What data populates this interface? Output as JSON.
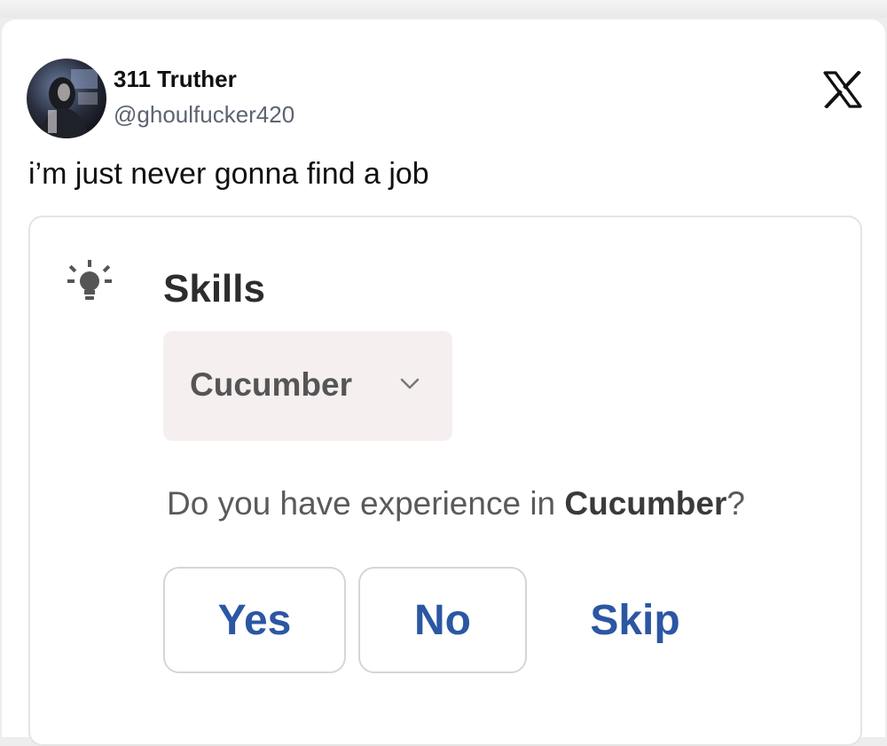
{
  "tweet": {
    "display_name": "311 Truther",
    "handle": "@ghoulfucker420",
    "text": "i’m just never gonna find a job"
  },
  "embedded_form": {
    "section_icon": "lightbulb-icon",
    "section_title": "Skills",
    "dropdown": {
      "selected": "Cucumber",
      "icon": "chevron-down-icon"
    },
    "question": {
      "prefix": "Do you have experience in ",
      "skill": "Cucumber",
      "suffix": "?"
    },
    "buttons": {
      "yes": "Yes",
      "no": "No",
      "skip": "Skip"
    }
  },
  "colors": {
    "button_text": "#2b57a3",
    "dropdown_bg": "#f6eff0",
    "card_border": "#e4e4e4"
  }
}
